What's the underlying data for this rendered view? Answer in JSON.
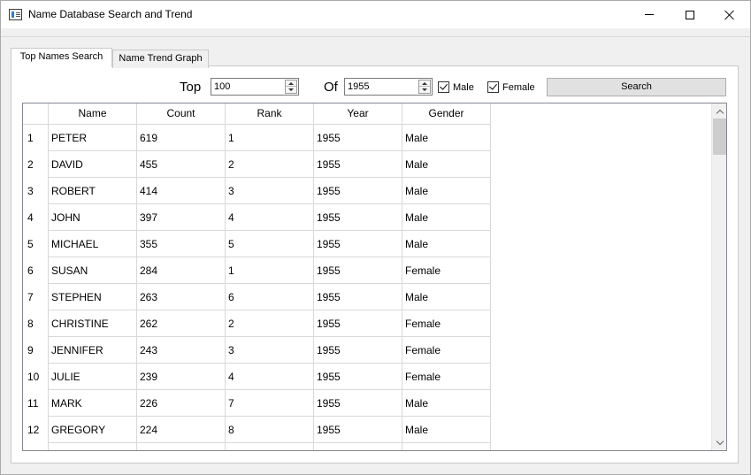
{
  "window": {
    "title": "Name Database Search and Trend"
  },
  "tabs": [
    {
      "label": "Top Names Search",
      "active": true
    },
    {
      "label": "Name Trend Graph",
      "active": false
    }
  ],
  "controls": {
    "top_label": "Top",
    "top_value": "100",
    "of_label": "Of",
    "year_value": "1955",
    "male_label": "Male",
    "male_checked": true,
    "female_label": "Female",
    "female_checked": true,
    "search_label": "Search"
  },
  "table": {
    "columns": [
      "Name",
      "Count",
      "Rank",
      "Year",
      "Gender"
    ],
    "rows": [
      {
        "num": "1",
        "name": "PETER",
        "count": "619",
        "rank": "1",
        "year": "1955",
        "gender": "Male"
      },
      {
        "num": "2",
        "name": "DAVID",
        "count": "455",
        "rank": "2",
        "year": "1955",
        "gender": "Male"
      },
      {
        "num": "3",
        "name": "ROBERT",
        "count": "414",
        "rank": "3",
        "year": "1955",
        "gender": "Male"
      },
      {
        "num": "4",
        "name": "JOHN",
        "count": "397",
        "rank": "4",
        "year": "1955",
        "gender": "Male"
      },
      {
        "num": "5",
        "name": "MICHAEL",
        "count": "355",
        "rank": "5",
        "year": "1955",
        "gender": "Male"
      },
      {
        "num": "6",
        "name": "SUSAN",
        "count": "284",
        "rank": "1",
        "year": "1955",
        "gender": "Female"
      },
      {
        "num": "7",
        "name": "STEPHEN",
        "count": "263",
        "rank": "6",
        "year": "1955",
        "gender": "Male"
      },
      {
        "num": "8",
        "name": "CHRISTINE",
        "count": "262",
        "rank": "2",
        "year": "1955",
        "gender": "Female"
      },
      {
        "num": "9",
        "name": "JENNIFER",
        "count": "243",
        "rank": "3",
        "year": "1955",
        "gender": "Female"
      },
      {
        "num": "10",
        "name": "JULIE",
        "count": "239",
        "rank": "4",
        "year": "1955",
        "gender": "Female"
      },
      {
        "num": "11",
        "name": "MARK",
        "count": "226",
        "rank": "7",
        "year": "1955",
        "gender": "Male"
      },
      {
        "num": "12",
        "name": "GREGORY",
        "count": "224",
        "rank": "8",
        "year": "1955",
        "gender": "Male"
      }
    ]
  }
}
